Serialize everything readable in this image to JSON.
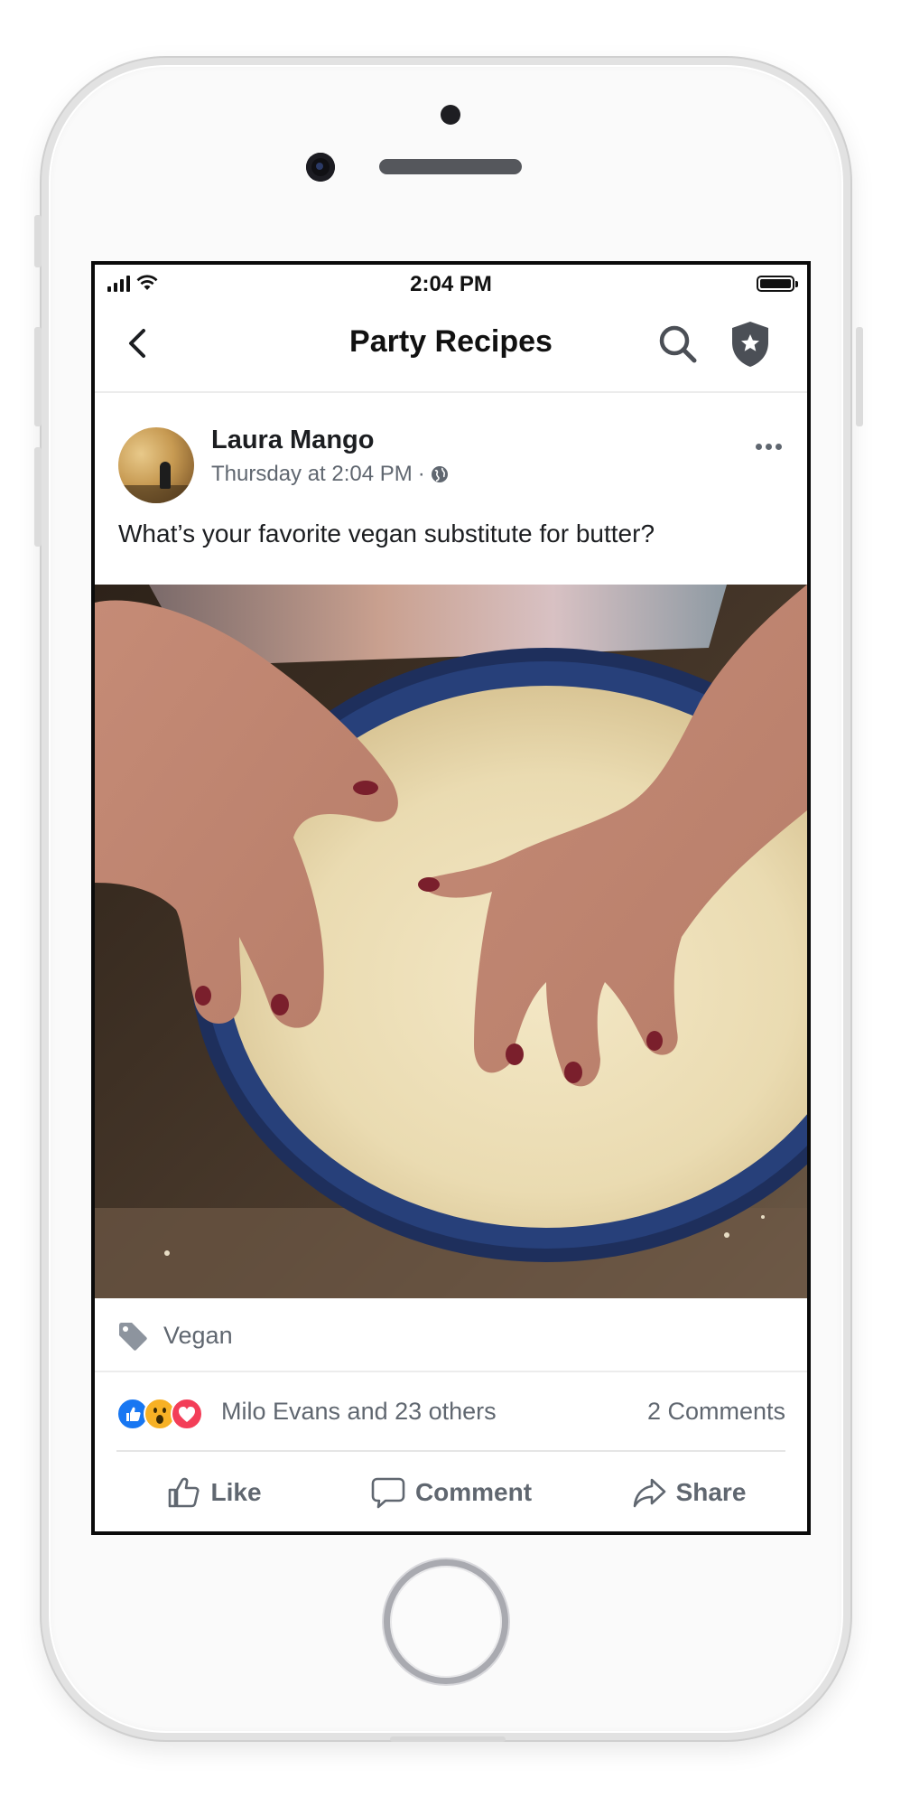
{
  "status_bar": {
    "time": "2:04 PM"
  },
  "nav": {
    "title": "Party Recipes",
    "icons": [
      "back-chevron-icon",
      "search-icon",
      "shield-star-icon"
    ]
  },
  "post": {
    "author": "Laura Mango",
    "timestamp": "Thursday at 2:04 PM",
    "separator": "·",
    "privacy_icon": "globe-icon",
    "text": "What’s your favorite vegan substitute for butter?",
    "photo_description_icon": "photo"
  },
  "tag": {
    "label": "Vegan",
    "icon": "tag-icon"
  },
  "reactions": {
    "icons": [
      "like-reaction-icon",
      "wow-reaction-icon",
      "love-reaction-icon"
    ],
    "summary": "Milo Evans and 23 others",
    "comments": "2 Comments"
  },
  "actions": {
    "like": "Like",
    "comment": "Comment",
    "share": "Share"
  },
  "colors": {
    "text_primary": "#1c1e21",
    "text_secondary": "#606770",
    "like_blue": "#1877f2",
    "wow_yellow": "#f7b125",
    "love_red": "#f33e58"
  }
}
